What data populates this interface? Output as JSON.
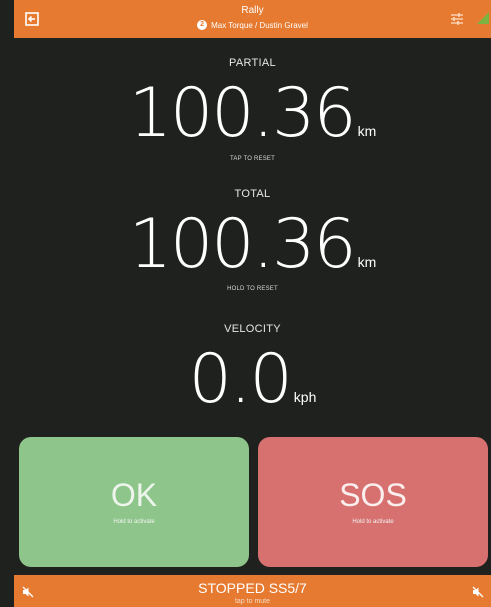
{
  "header": {
    "title": "Rally",
    "badge": "2",
    "subtitle": "Max Torque / Dustin Gravel",
    "exit_icon": "exit-icon",
    "tune_icon": "tune-icon",
    "signal_icon": "signal-icon"
  },
  "partial": {
    "label": "PARTIAL",
    "value": "100.36",
    "unit": "km",
    "hint": "TAP TO RESET"
  },
  "total": {
    "label": "TOTAL",
    "value": "100.36",
    "unit": "km",
    "hint": "HOLD TO RESET"
  },
  "velocity": {
    "label": "VELOCITY",
    "value": "0.0",
    "unit": "kph"
  },
  "ok_button": {
    "label": "OK",
    "hint": "Hold to activate"
  },
  "sos_button": {
    "label": "SOS",
    "hint": "Hold to activate"
  },
  "status_bar": {
    "status": "STOPPED SS5/7",
    "hint": "tap to mute",
    "mute_icon": "volume-off-icon"
  },
  "colors": {
    "accent": "#e57a30",
    "background": "#1f211f",
    "ok": "#8ec58a",
    "sos": "#d6716f",
    "signal": "#7cb342"
  }
}
